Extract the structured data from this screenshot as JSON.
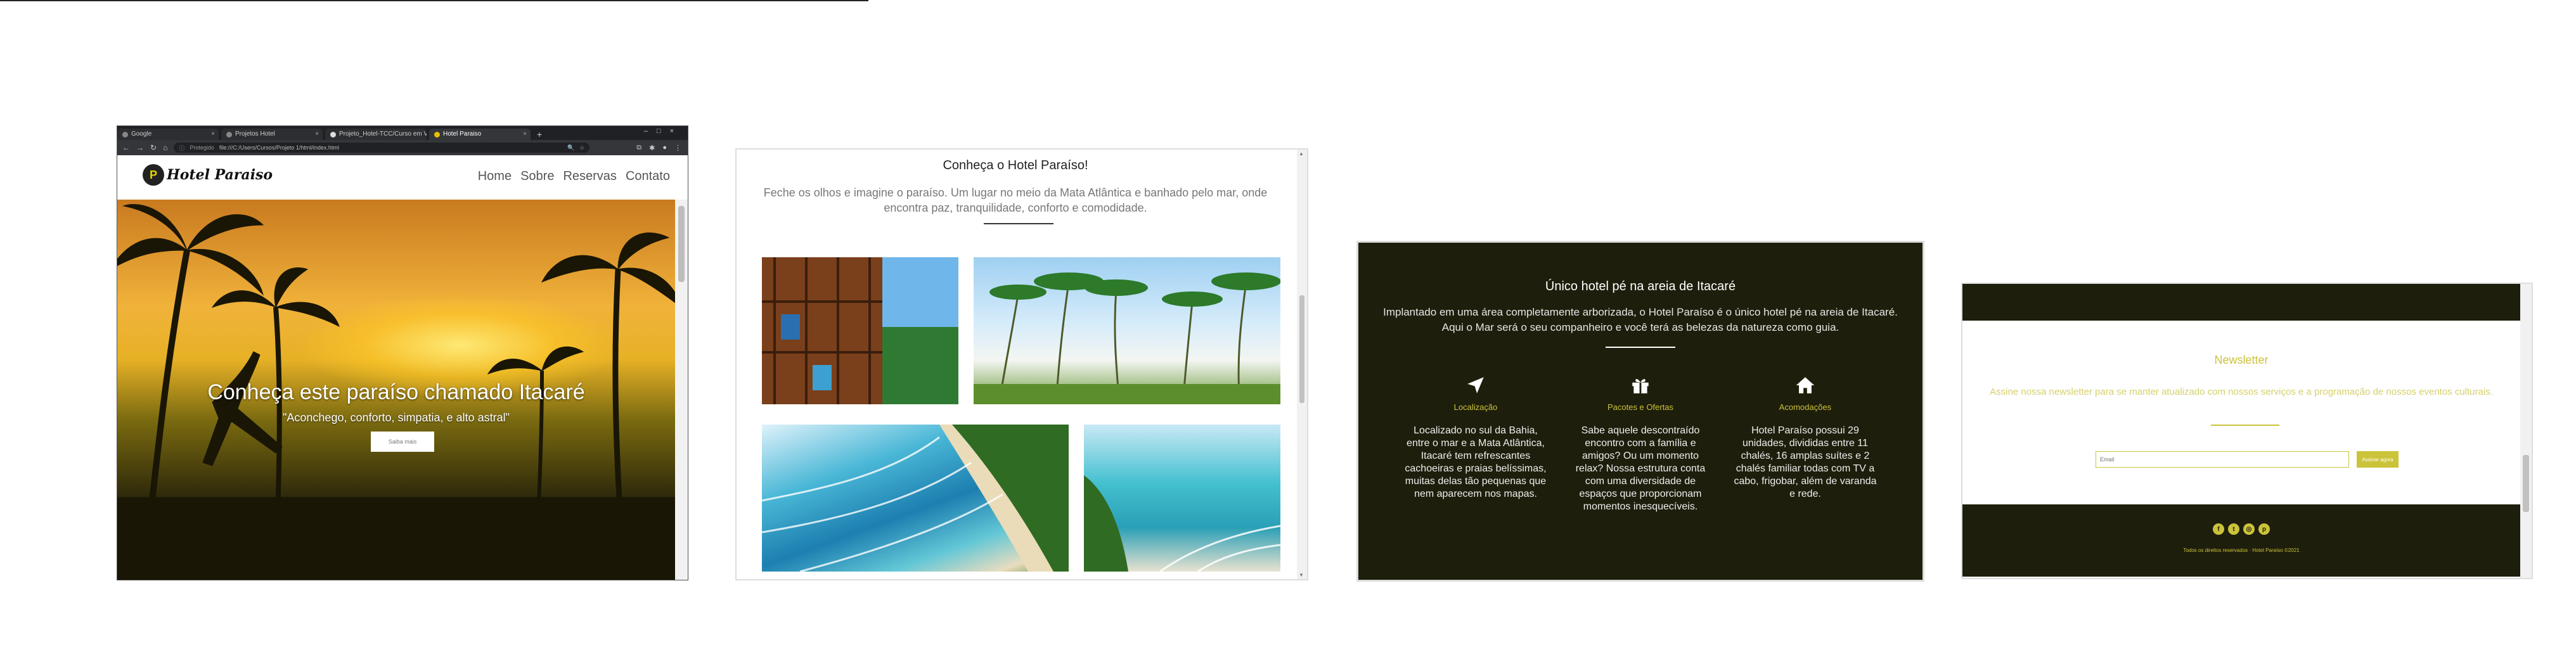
{
  "browser": {
    "tabs": [
      {
        "label": "Google"
      },
      {
        "label": "Projetos Hotel"
      },
      {
        "label": "Projeto_Hotel-TCC/Curso em Vi..."
      },
      {
        "label": "Hotel Paraiso",
        "active": true
      }
    ],
    "new_tab": "+",
    "address": {
      "warning": "Protegido",
      "url": "file:///C:/Users/Cursos/Projeto 1/html/index.html"
    }
  },
  "site": {
    "logo_letter": "P",
    "logo_text": "Hotel Paraiso",
    "menu": [
      "Home",
      "Sobre",
      "Reservas",
      "Contato"
    ],
    "hero": {
      "title": "Conheça este paraíso chamado Itacaré",
      "subtitle": "\"Aconchego, conforto, simpatia, e alto astral\"",
      "button": "Saiba mais"
    }
  },
  "gallery": {
    "title": "Conheça o Hotel Paraíso!",
    "text": "Feche os olhos e imagine o paraíso. Um lugar no meio da Mata Atlântica e banhado pelo mar, onde encontra paz, tranquilidade, conforto e comodidade."
  },
  "features": {
    "title": "Único hotel pé na areia de Itacaré",
    "text": "Implantado em uma área completamente arborizada, o Hotel Paraíso é o único hotel pé na areia de Itacaré. Aqui o Mar será o seu companheiro e você terá as belezas da natureza como guia.",
    "items": [
      {
        "icon": "location-arrow-icon",
        "title": "Localização",
        "desc": "Localizado no sul da Bahia, entre o mar e a Mata Atlântica, Itacaré tem refrescantes cachoeiras e praias belíssimas, muitas delas tão pequenas que nem aparecem nos mapas."
      },
      {
        "icon": "gift-icon",
        "title": "Pacotes e Ofertas",
        "desc": "Sabe aquele descontraído encontro com a família e amigos? Ou um momento relax? Nossa estrutura conta com uma diversidade de espaços que proporcionam momentos inesquecíveis."
      },
      {
        "icon": "home-icon",
        "title": "Acomodações",
        "desc": "Hotel Paraíso possui 29 unidades, divididas entre 11 chalés, 16 amplas suítes e 2 chalés familiar todas com TV a cabo, frigobar, além de varanda e rede."
      }
    ]
  },
  "newsletter": {
    "title": "Newsletter",
    "text": "Assine nossa newsletter para se manter atualizado com nossos serviços e a programação de nossos eventos culturais.",
    "email_placeholder": "Email",
    "button": "Assinar agora",
    "socials": [
      "facebook-icon",
      "twitter-icon",
      "instagram-icon",
      "pinterest-icon"
    ],
    "copyright": "Todos os direitos reservados · Hotel Paraíso ©2021"
  },
  "colors": {
    "accent": "#cbc33a",
    "dark": "#1e1e0c"
  }
}
